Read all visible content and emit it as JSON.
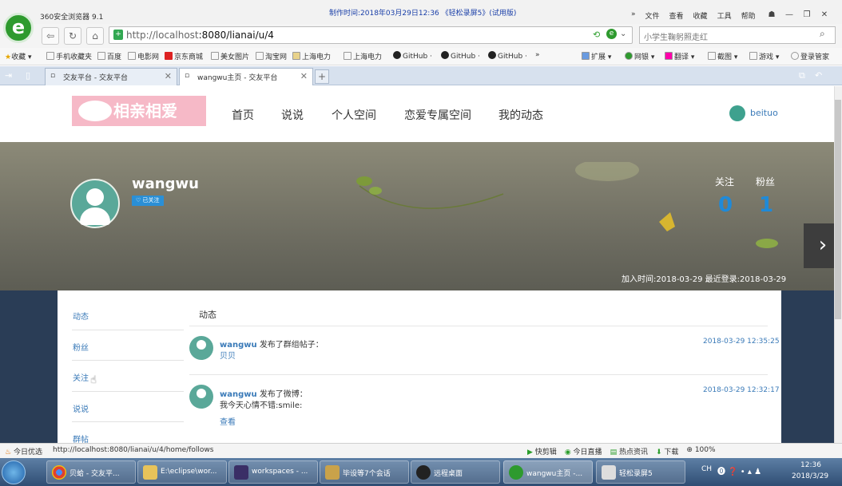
{
  "browser": {
    "app_title": "360安全浏览器 9.1",
    "recording_banner": "制作时间:2018年03月29日12:36 《轻松录屏5》(试用版)",
    "menu": [
      "»",
      "文件",
      "查看",
      "收藏",
      "工具",
      "帮助"
    ],
    "address_host": "http://localhost",
    "address_rest": ":8080/lianai/u/4",
    "search_placeholder": "小学生鞠躬照走红",
    "bookmarks": [
      "收藏",
      "手机收藏夹",
      "百度",
      "电影网",
      "京东商城",
      "美女图片",
      "淘宝网",
      "上海电力",
      "上海电力",
      "GitHub ·",
      "GitHub ·",
      "GitHub ·",
      "»",
      "扩展",
      "网银",
      "翻译",
      "截图",
      "游戏",
      "登录管家"
    ],
    "tabs": [
      {
        "label": "交友平台 - 交友平台"
      },
      {
        "label": "wangwu主页 - 交友平台"
      }
    ],
    "new_tab": "+"
  },
  "site": {
    "logo_text": "相亲相爱",
    "nav": [
      "首页",
      "说说",
      "个人空间",
      "恋爱专属空间",
      "我的动态"
    ],
    "current_user": "beituo"
  },
  "profile": {
    "name": "wangwu",
    "follow_badge": "♡ 已关注",
    "following_label": "关注",
    "following_count": "0",
    "fans_label": "粉丝",
    "fans_count": "1",
    "join_info": "加入时间:2018-03-29 最近登录:2018-03-29"
  },
  "sidebar": [
    "动态",
    "粉丝",
    "关注",
    "说说",
    "群帖"
  ],
  "feed": {
    "title": "动态",
    "items": [
      {
        "user": "wangwu",
        "action": "发布了群组帖子：",
        "content": "贝贝",
        "time": "2018-03-29 12:35:25"
      },
      {
        "user": "wangwu",
        "action": "发布了微博：",
        "content": "我今天心情不错:smile:",
        "link": "查看",
        "time": "2018-03-29 12:32:17"
      }
    ]
  },
  "status": {
    "left": "今日优选",
    "url": "http://localhost:8080/lianai/u/4/home/follows",
    "right": [
      "快剪辑",
      "今日直播",
      "热点资讯",
      "下载",
      "100%"
    ]
  },
  "taskbar": {
    "items": [
      "贝蛤 - 交友平...",
      "E:\\eclipse\\wor...",
      "workspaces - ...",
      "毕设等7个会话",
      "远程桌面",
      "wangwu主页 -...",
      "轻松录屏5"
    ],
    "tray": "CH",
    "time": "12:36",
    "date": "2018/3/29"
  },
  "colors": {
    "accent": "#1f8ad8",
    "link": "#3a7ab8",
    "logo_bg": "#f6b9c7",
    "avatar": "#5aa899"
  }
}
